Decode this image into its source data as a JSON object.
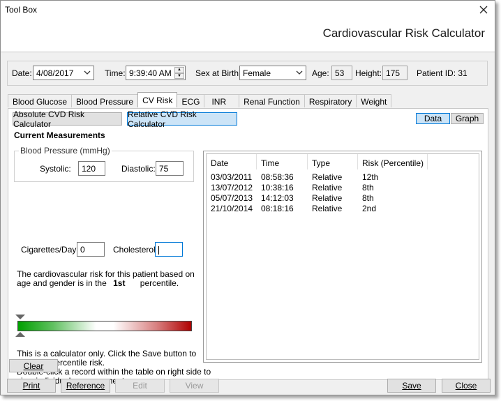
{
  "window": {
    "title": "Tool Box",
    "app_title": "Cardiovascular Risk Calculator"
  },
  "topbar": {
    "date_label": "Date:",
    "date_value": "4/08/2017",
    "time_label": "Time:",
    "time_value": "9:39:40 AM",
    "sex_label": "Sex at Birth:",
    "sex_value": "Female",
    "age_label": "Age:",
    "age_value": "53",
    "height_label": "Height:",
    "height_value": "175",
    "patient_id": "Patient ID: 31"
  },
  "tabs": [
    {
      "label": "Blood Glucose"
    },
    {
      "label": "Blood Pressure"
    },
    {
      "label": "CV Risk"
    },
    {
      "label": "ECG"
    },
    {
      "label": "INR"
    },
    {
      "label": "Renal Function"
    },
    {
      "label": "Respiratory"
    },
    {
      "label": "Weight"
    }
  ],
  "panel": {
    "absolute_btn": "Absolute CVD Risk Calculator",
    "relative_btn": "Relative CVD Risk Calculator",
    "data_btn": "Data",
    "graph_btn": "Graph",
    "section_title": "Current Measurements",
    "bp_group": "Blood Pressure (mmHg)",
    "systolic_label": "Systolic:",
    "systolic_value": "120",
    "diastolic_label": "Diastolic:",
    "diastolic_value": "75",
    "cig_label": "Cigarettes/Day:",
    "cig_value": "0",
    "chol_label": "Cholesterol:",
    "chol_value": "",
    "risk_line1": "The cardiovascular risk for this patient based on",
    "risk_line2_a": "age and gender is in the",
    "risk_percentile": "1st",
    "risk_line2_b": "percentile.",
    "risk_slider_level": 0.0,
    "info_line1": "This is a calculator only. Click the Save button to",
    "info_line2": "save the percentile risk.",
    "info_line3": "Double-click a record within the table on right side to",
    "info_line4": "view individual measurements.",
    "clear_btn": "Clear"
  },
  "table": {
    "columns": [
      "Date",
      "Time",
      "Type",
      "Risk (Percentile)"
    ],
    "rows": [
      [
        "03/03/2011",
        "08:58:36",
        "Relative",
        "12th"
      ],
      [
        "13/07/2012",
        "10:38:16",
        "Relative",
        "8th"
      ],
      [
        "05/07/2013",
        "14:12:03",
        "Relative",
        "8th"
      ],
      [
        "21/10/2014",
        "08:18:16",
        "Relative",
        "2nd"
      ]
    ]
  },
  "footer": {
    "print": "Print",
    "reference": "Reference",
    "edit": "Edit",
    "view": "View",
    "save": "Save",
    "close": "Close"
  }
}
